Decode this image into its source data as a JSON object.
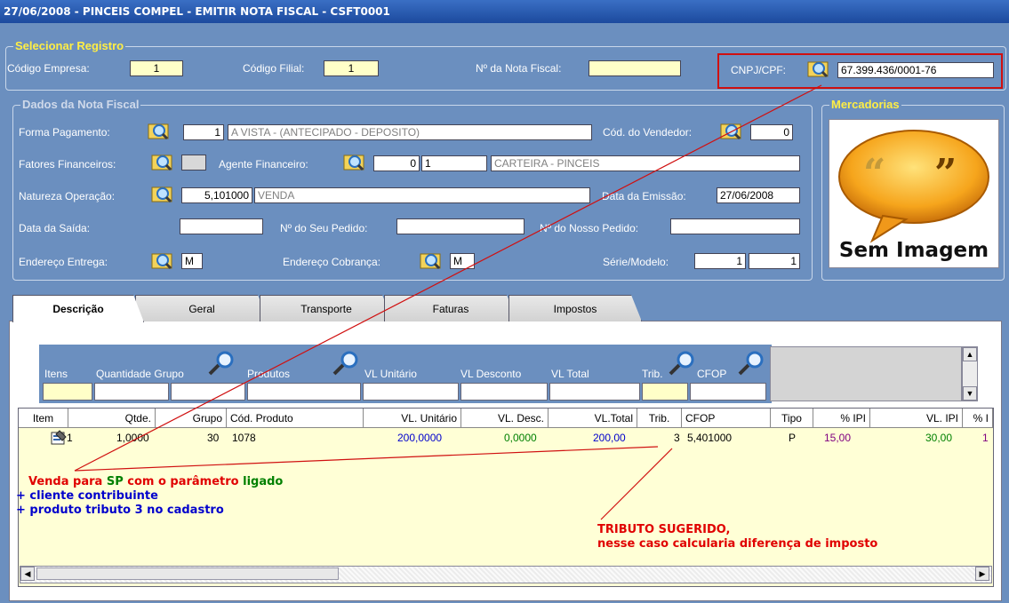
{
  "window": {
    "title": "27/06/2008  -  PINCEIS COMPEL  -  EMITIR NOTA FISCAL  -  CSFT0001"
  },
  "selecionar": {
    "legend": "Selecionar Registro",
    "codigo_empresa_label": "Código Empresa:",
    "codigo_empresa": "1",
    "codigo_filial_label": "Código Filial:",
    "codigo_filial": "1",
    "nota_fiscal_label": "Nº da Nota Fiscal:",
    "nota_fiscal": "",
    "cnpj_label": "CNPJ/CPF:",
    "cnpj": "67.399.436/0001-76"
  },
  "dados": {
    "legend": "Dados da Nota Fiscal",
    "forma_pagamento_label": "Forma  Pagamento:",
    "forma_pagamento_code": "1",
    "forma_pagamento_desc": "A VISTA - (ANTECIPADO - DEPOSITO)",
    "vendedor_label": "Cód. do Vendedor:",
    "vendedor": "0",
    "fatores_label": "Fatores Financeiros:",
    "agente_label": "Agente Financeiro:",
    "agente_code1": "0",
    "agente_code2": "1",
    "agente_desc": "CARTEIRA - PINCEIS",
    "natureza_label": "Natureza Operação:",
    "natureza_code": "5,101000",
    "natureza_desc": "VENDA",
    "emissao_label": "Data da  Emissão:",
    "emissao": "27/06/2008",
    "saida_label": "Data da Saída:",
    "seu_pedido_label": "Nº do Seu Pedido:",
    "nosso_pedido_label": "Nº do Nosso Pedido:",
    "end_entrega_label": "Endereço  Entrega:",
    "end_entrega": "M",
    "end_cobranca_label": "Endereço Cobrança:",
    "end_cobranca": "M",
    "serie_label": "Série/Modelo:",
    "serie": "1",
    "modelo": "1"
  },
  "mercadorias": {
    "legend": "Mercadorias",
    "image_text": "Sem Imagem"
  },
  "tabs": [
    {
      "label": "Descrição"
    },
    {
      "label": "Geral"
    },
    {
      "label": "Transporte"
    },
    {
      "label": "Faturas"
    },
    {
      "label": "Impostos"
    }
  ],
  "filters": {
    "itens": "Itens",
    "quantidade_grupo": "Quantidade Grupo",
    "produtos": "Produtos",
    "vl_unitario": "VL Unitário",
    "vl_desconto": "VL Desconto",
    "vl_total": "VL Total",
    "trib": "Trib.",
    "cfop": "CFOP"
  },
  "grid": {
    "columns": [
      "Item",
      "Qtde.",
      "Grupo",
      "Cód. Produto",
      "VL. Unitário",
      "VL. Desc.",
      "VL.Total",
      "Trib.",
      "CFOP",
      "Tipo",
      "% IPI",
      "VL. IPI",
      "% I"
    ],
    "rows": [
      {
        "item": "1",
        "qtde": "1,0000",
        "grupo": "30",
        "cod_produto": "1078",
        "vl_unitario": "200,0000",
        "vl_desc": "0,0000",
        "vl_total": "200,00",
        "trib": "3",
        "cfop": "5,401000",
        "tipo": "P",
        "pct_ipi": "15,00",
        "vl_ipi": "30,00",
        "pct_i": "1"
      }
    ]
  },
  "notes": {
    "n1_a": "Venda para ",
    "n1_b": "SP",
    "n1_c": " com o parâmetro ",
    "n1_d": "ligado",
    "n2": "+ cliente contribuinte",
    "n3": "+ produto tributo 3 no cadastro",
    "n4": "TRIBUTO SUGERIDO,",
    "n5": "nesse caso calcularia diferença de imposto"
  },
  "colors": {
    "window_bg": "#6b8fbf",
    "title_bar": "#1c4a9e",
    "legend": "#ffee44",
    "note_red": "#e00000",
    "note_green": "#008000",
    "note_blue": "#0000cc",
    "arrow": "#d01010"
  }
}
